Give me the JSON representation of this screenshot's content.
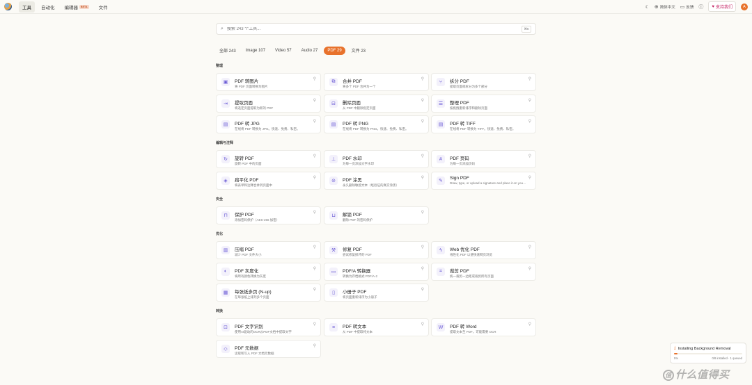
{
  "nav": {
    "tabs": [
      {
        "label": "工具",
        "active": true
      },
      {
        "label": "自动化",
        "active": false
      },
      {
        "label": "编辑器",
        "badge": "BETA",
        "active": false
      },
      {
        "label": "文件",
        "active": false
      }
    ]
  },
  "topright": {
    "lang": "简体中文",
    "feedback": "反馈",
    "support": "支持我们",
    "avatar": "A"
  },
  "search": {
    "placeholder": "搜索 243 个工具...",
    "shortcut": "⌘K"
  },
  "filters": [
    {
      "label": "全部 243",
      "active": false
    },
    {
      "label": "Image 107",
      "active": false
    },
    {
      "label": "Video 57",
      "active": false
    },
    {
      "label": "Audio 27",
      "active": false
    },
    {
      "label": "PDF 29",
      "active": true
    },
    {
      "label": "文件 23",
      "active": false
    }
  ],
  "sections": [
    {
      "title": "整理",
      "tools": [
        {
          "title": "PDF 转图片",
          "desc": "将 PDF 页面转换为图片",
          "icon": "image-icon"
        },
        {
          "title": "合并 PDF",
          "desc": "将多个 PDF 合并为一个",
          "icon": "merge-icon"
        },
        {
          "title": "拆分 PDF",
          "desc": "提取页面或拆分为多个部分",
          "icon": "split-icon"
        },
        {
          "title": "提取页面",
          "desc": "将选定页面提取为新的 PDF",
          "icon": "extract-icon"
        },
        {
          "title": "删除页面",
          "desc": "从 PDF 中删除指定页面",
          "icon": "delete-page-icon"
        },
        {
          "title": "整理 PDF",
          "desc": "按拖拽重新排序和删除页面",
          "icon": "organize-icon"
        },
        {
          "title": "PDF 转 JPG",
          "desc": "在线将 PDF 转换为 JPG。快速、免费、私密。",
          "icon": "file-icon"
        },
        {
          "title": "PDF 转 PNG",
          "desc": "在线将 PDF 转换为 PNG。快速、免费、私密。",
          "icon": "file-icon"
        },
        {
          "title": "PDF 转 TIFF",
          "desc": "在线将 PDF 转换为 TIFF。快速、免费、私密。",
          "icon": "file-icon"
        }
      ]
    },
    {
      "title": "编辑与注释",
      "tools": [
        {
          "title": "旋转 PDF",
          "desc": "旋转 PDF 中的页面",
          "icon": "rotate-icon"
        },
        {
          "title": "PDF 水印",
          "desc": "为每一页添加文字水印",
          "icon": "stamp-icon"
        },
        {
          "title": "PDF 页码",
          "desc": "为每一页添加页码",
          "icon": "hash-icon"
        },
        {
          "title": "扁平化 PDF",
          "desc": "将表单和注释合并到页面中",
          "icon": "layers-icon"
        },
        {
          "title": "PDF 涂黑",
          "desc": "永久删除敏感文本（经验证的真实涂黑）",
          "icon": "eye-off-icon"
        },
        {
          "title": "Sign PDF",
          "desc": "Draw, type, or upload a signature and place it on your PDF",
          "icon": "signature-icon"
        }
      ]
    },
    {
      "title": "安全",
      "tools": [
        {
          "title": "保护 PDF",
          "desc": "添加密码保护（AES-256 加密）",
          "icon": "lock-icon"
        },
        {
          "title": "解锁 PDF",
          "desc": "删除 PDF 的密码保护",
          "icon": "unlock-icon"
        }
      ]
    },
    {
      "title": "优化",
      "tools": [
        {
          "title": "压缩 PDF",
          "desc": "减少 PDF 文件大小",
          "icon": "compress-icon"
        },
        {
          "title": "修复 PDF",
          "desc": "尝试修复损坏的 PDF",
          "icon": "wrench-icon"
        },
        {
          "title": "Web 优化 PDF",
          "desc": "线性化 PDF 以便快速网页浏览",
          "icon": "bolt-icon"
        },
        {
          "title": "PDF 灰度化",
          "desc": "将所有颜色转换为灰度",
          "icon": "contrast-icon"
        },
        {
          "title": "PDF/A 转换器",
          "desc": "转换为存档格式 PDF/A-2",
          "icon": "archive-icon"
        },
        {
          "title": "裁剪 PDF",
          "desc": "统一裁剪一边距或裁剪所有页面",
          "icon": "crop-icon"
        },
        {
          "title": "每张纸多页 (N-up)",
          "desc": "在每张纸上排列多个页面",
          "icon": "grid-icon"
        },
        {
          "title": "小册子 PDF",
          "desc": "将页面重新排序为小册子",
          "icon": "book-icon"
        }
      ]
    },
    {
      "title": "转换",
      "tools": [
        {
          "title": "PDF 文字识别",
          "desc": "使用AI驱动的OCR从PDF文档中提取文字",
          "icon": "scan-icon"
        },
        {
          "title": "PDF 转文本",
          "desc": "从 PDF 中提取纯文本",
          "icon": "text-icon"
        },
        {
          "title": "PDF 转 Word",
          "desc": "提取文本至 PDF，可能需要 OCR",
          "icon": "word-icon"
        },
        {
          "title": "PDF 元数据",
          "desc": "读取和写入 PDF 文档元数据",
          "icon": "tag-icon"
        }
      ]
    }
  ],
  "toast": {
    "title": "Installing Background Removal",
    "percent": "5%",
    "progress": 0.05,
    "status": "0/8 installed · 1 queued"
  },
  "watermark": "什么值得买"
}
